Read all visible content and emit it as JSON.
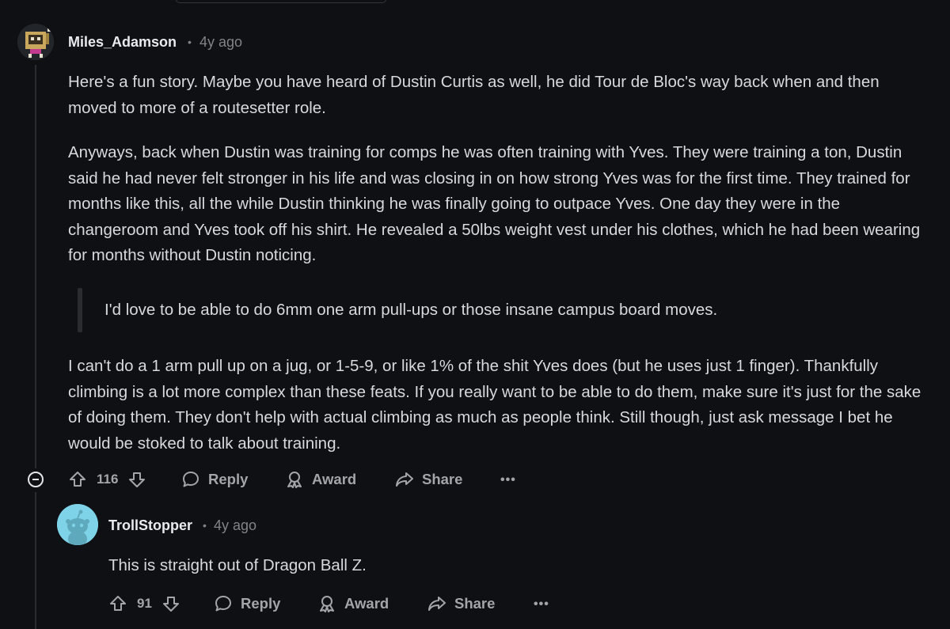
{
  "comments": [
    {
      "username": "Miles_Adamson",
      "separator": "•",
      "time": "4y ago",
      "paragraphs": [
        "Here's a fun story. Maybe you have heard of Dustin Curtis as well, he did Tour de Bloc's way back when and then moved to more of a routesetter role.",
        "Anyways, back when Dustin was training for comps he was often training with Yves. They were training a ton, Dustin said he had never felt stronger in his life and was closing in on how strong Yves was for the first time. They trained for months like this, all the while Dustin thinking he was finally going to outpace Yves. One day they were in the changeroom and Yves took off his shirt. He revealed a 50lbs weight vest under his clothes, which he had been wearing for months without Dustin noticing."
      ],
      "quote": "I'd love to be able to do 6mm one arm pull-ups or those insane campus board moves.",
      "after_quote": "I can't do a 1 arm pull up on a jug, or 1-5-9, or like 1% of the shit Yves does (but he uses just 1 finger). Thankfully climbing is a lot more complex than these feats. If you really want to be able to do them, make sure it's just for the sake of doing them. They don't help with actual climbing as much as people think. Still though, just ask message I bet he would be stoked to talk about training.",
      "votes": "116",
      "actions": {
        "reply": "Reply",
        "award": "Award",
        "share": "Share",
        "more": "•••"
      }
    },
    {
      "username": "TrollStopper",
      "separator": "•",
      "time": "4y ago",
      "text": "This is straight out of Dragon Ball Z.",
      "votes": "91",
      "actions": {
        "reply": "Reply",
        "award": "Award",
        "share": "Share",
        "more": "•••"
      }
    }
  ],
  "icons": {
    "avatar1": "pixel-robot-avatar",
    "avatar2": "snoo-avatar",
    "collapse": "collapse-minus-icon",
    "upvote": "upvote-arrow-icon",
    "downvote": "downvote-arrow-icon",
    "reply": "speech-bubble-icon",
    "award": "award-ribbon-icon",
    "share": "share-arrow-icon"
  },
  "colors": {
    "background": "#0e1013",
    "text": "#d7dadc",
    "muted": "#818384",
    "action": "#a3a6a8",
    "thread_line": "#2a2c30",
    "snoo_bg": "#7fd3e8"
  }
}
